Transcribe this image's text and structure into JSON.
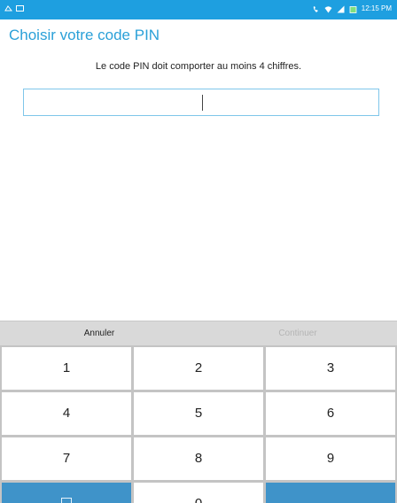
{
  "status_bar": {
    "time": "12:15 PM",
    "icons": [
      "notification-icon",
      "image-icon",
      "phone-icon",
      "wifi-icon",
      "signal-icon",
      "battery-icon"
    ]
  },
  "header": {
    "title": "Choisir votre code PIN"
  },
  "instruction": "Le code PIN doit comporter au moins 4 chiffres.",
  "pin_field": {
    "value": ""
  },
  "actions": {
    "cancel_label": "Annuler",
    "continue_label": "Continuer"
  },
  "keypad": {
    "keys": [
      "1",
      "2",
      "3",
      "4",
      "5",
      "6",
      "7",
      "8",
      "9",
      "0"
    ]
  },
  "colors": {
    "accent": "#2aa0d8",
    "status_bar": "#1e9fe0",
    "key_special": "#3f93c9"
  }
}
